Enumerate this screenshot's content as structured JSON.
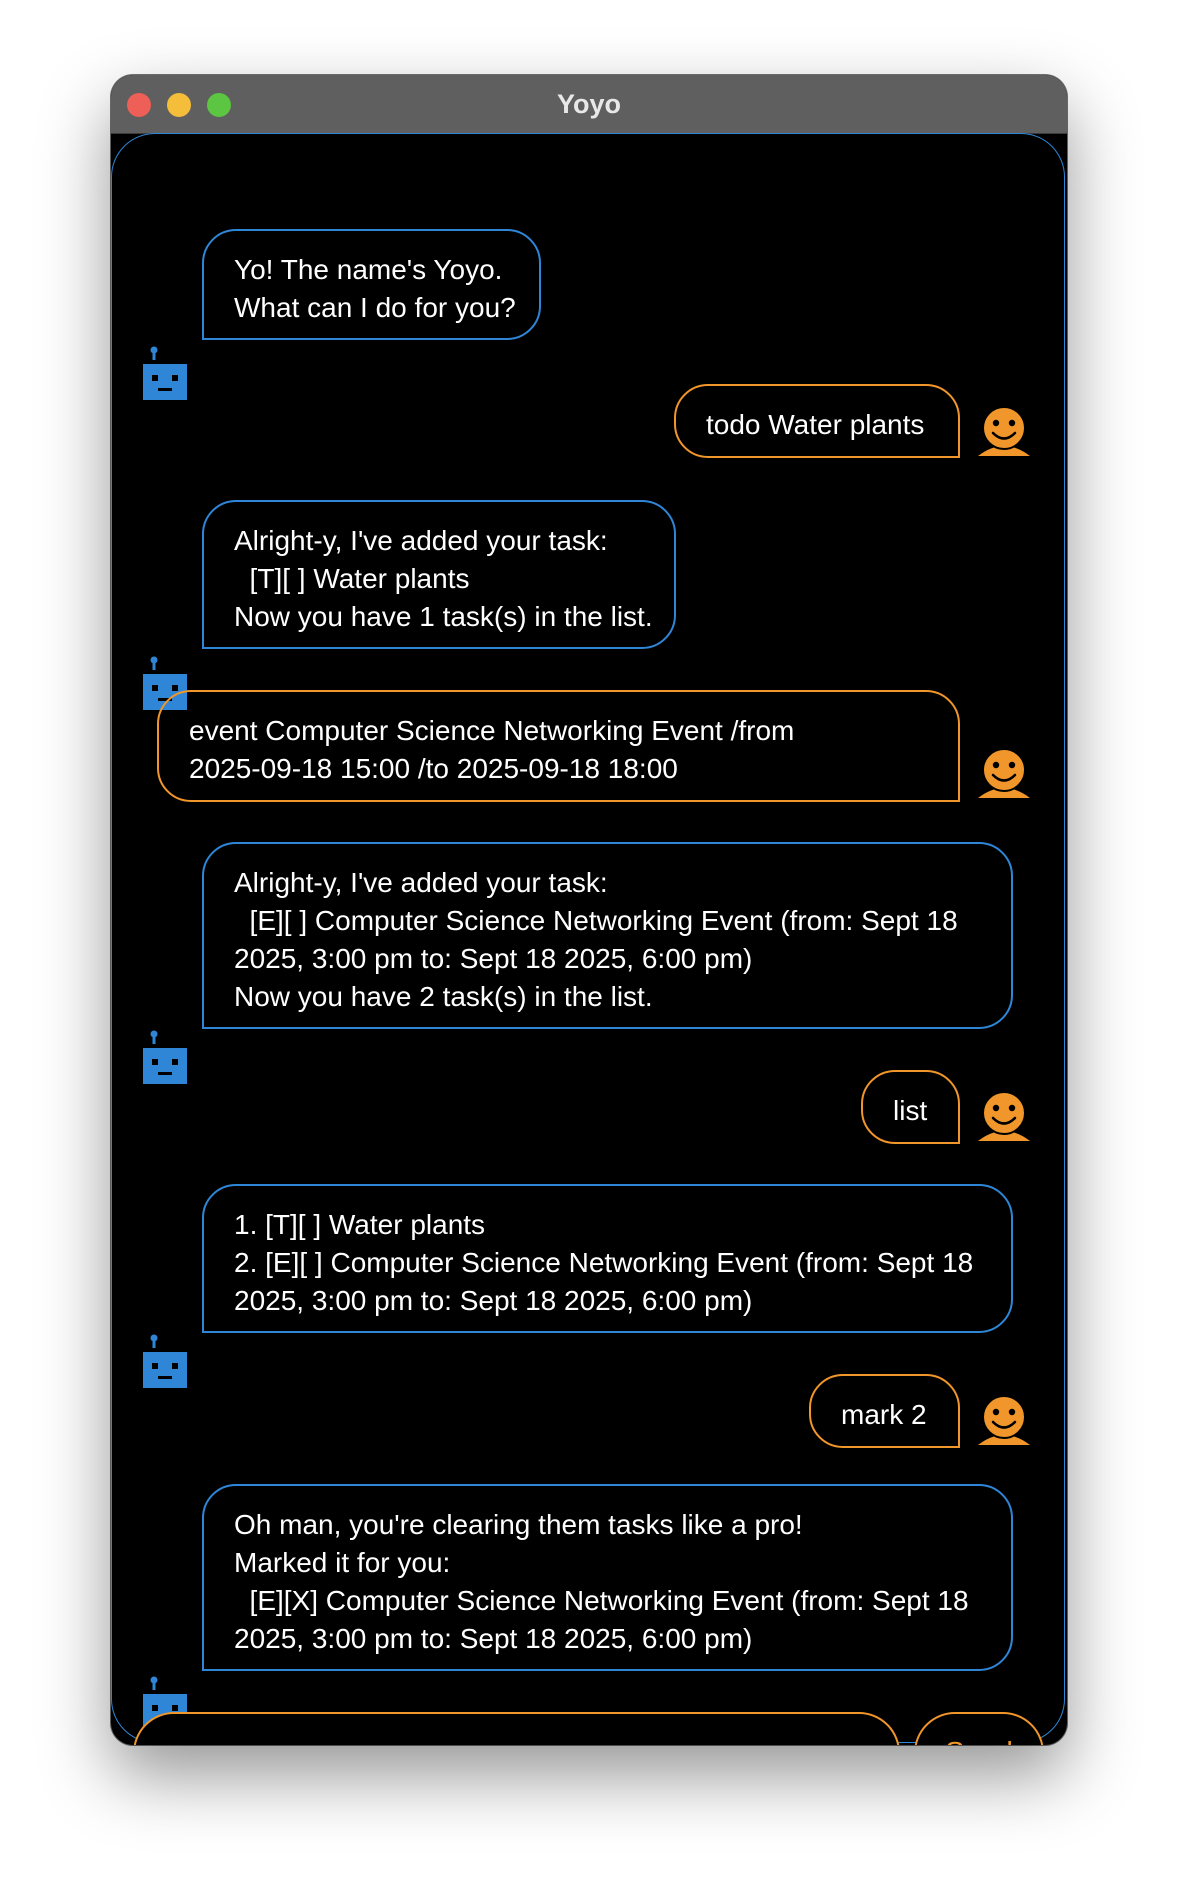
{
  "window": {
    "title": "Yoyo"
  },
  "messages": [
    {
      "sender": "bot",
      "text": "Yo! The name's Yoyo.\nWhat can I do for you?"
    },
    {
      "sender": "user",
      "text": "todo Water plants"
    },
    {
      "sender": "bot",
      "text": "Alright-y, I've added your task:\n  [T][ ] Water plants\nNow you have 1 task(s) in the list."
    },
    {
      "sender": "user",
      "text": "event Computer Science Networking Event /from\n2025-09-18 15:00 /to 2025-09-18 18:00"
    },
    {
      "sender": "bot",
      "text": "Alright-y, I've added your task:\n  [E][ ] Computer Science Networking Event (from: Sept 18\n2025, 3:00 pm to: Sept 18 2025, 6:00 pm)\nNow you have 2 task(s) in the list."
    },
    {
      "sender": "user",
      "text": "list"
    },
    {
      "sender": "bot",
      "text": "1. [T][ ] Water plants\n2. [E][ ] Computer Science Networking Event (from: Sept 18\n2025, 3:00 pm to: Sept 18 2025, 6:00 pm)"
    },
    {
      "sender": "user",
      "text": "mark 2"
    },
    {
      "sender": "bot",
      "text": "Oh man, you're clearing them tasks like a pro!\nMarked it for you:\n  [E][X] Computer Science Networking Event (from: Sept 18\n2025, 3:00 pm to: Sept 18 2025, 6:00 pm)"
    }
  ],
  "input": {
    "value": "",
    "placeholder": ""
  },
  "send_button": {
    "label": "Send"
  },
  "icons": {
    "bot_avatar": "robot-icon",
    "user_avatar": "smiley-user-icon"
  },
  "colors": {
    "bot_accent": "#2f86d6",
    "user_accent": "#f0962a",
    "background": "#000000"
  }
}
